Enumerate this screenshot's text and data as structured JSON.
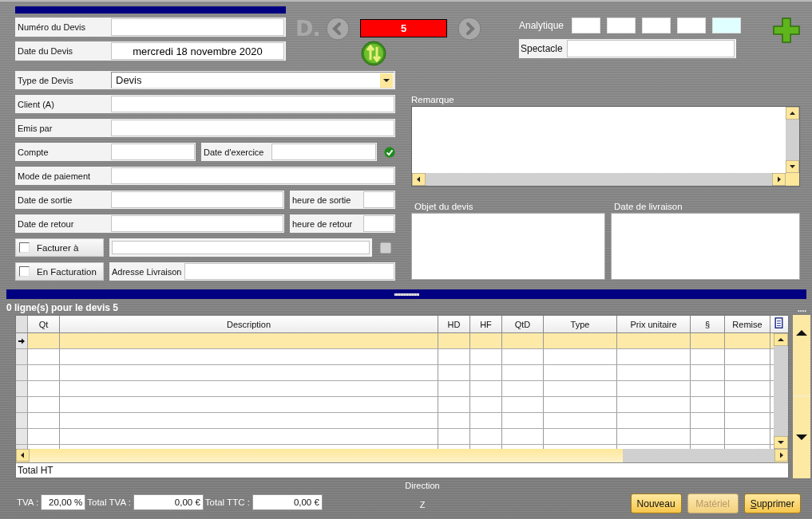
{
  "header": {
    "numero": {
      "label": "Numéro du Devis"
    },
    "date": {
      "label": "Date du Devis",
      "value": "mercredi 18 novembre 2020"
    }
  },
  "nav": {
    "logo": "D.",
    "counter": "5"
  },
  "analytique": {
    "label": "Analytique",
    "boxes": [
      {
        "highlighted": false
      },
      {
        "highlighted": false
      },
      {
        "highlighted": false
      },
      {
        "highlighted": false
      },
      {
        "highlighted": true
      }
    ]
  },
  "spectacle": {
    "label": "Spectacle"
  },
  "form": {
    "type": {
      "label": "Type de Devis",
      "value": "Devis"
    },
    "client": {
      "label": "Client (A)"
    },
    "emis": {
      "label": "Emis par"
    },
    "compte": {
      "label": "Compte"
    },
    "exercice": {
      "label": "Date d'exercice"
    },
    "paiement": {
      "label": "Mode de paiement"
    },
    "sortie": {
      "label": "Date de sortie"
    },
    "heure_sortie": {
      "label": "heure de sortie"
    },
    "retour": {
      "label": "Date de retour"
    },
    "heure_retour": {
      "label": "heure de retour"
    },
    "facturer": {
      "label": "Facturer à",
      "checked": false
    },
    "en_facturation": {
      "label": "En Facturation",
      "checked": false
    },
    "adresse": {
      "label": "Adresse Livraison"
    }
  },
  "remarque": {
    "label": "Remarque"
  },
  "objet": {
    "label": "Objet du devis"
  },
  "livraison": {
    "label": "Date de livraison"
  },
  "lines": {
    "title": "0 ligne(s) pour le devis 5",
    "more": "....",
    "columns": [
      "Qt",
      "Description",
      "HD",
      "HF",
      "QtD",
      "Type",
      "Prix unitaire",
      "§",
      "Remise"
    ],
    "rows": [
      {
        "selected": true
      },
      {
        "selected": false
      },
      {
        "selected": false
      },
      {
        "selected": false
      },
      {
        "selected": false
      },
      {
        "selected": false
      },
      {
        "selected": false
      }
    ],
    "total_label": "Total HT"
  },
  "footer": {
    "direction": "Direction",
    "z": "Z",
    "tva": {
      "label": "TVA :",
      "value": "20,00 %"
    },
    "total_tva": {
      "label": "Total TVA :",
      "value": "0,00 €"
    },
    "total_ttc": {
      "label": "Total TTC :",
      "value": "0,00 €"
    }
  },
  "buttons": [
    {
      "label": "Nouveau",
      "disabled": false
    },
    {
      "label": "Matériel",
      "disabled": true
    },
    {
      "label": "Supprimer",
      "disabled": false
    }
  ]
}
